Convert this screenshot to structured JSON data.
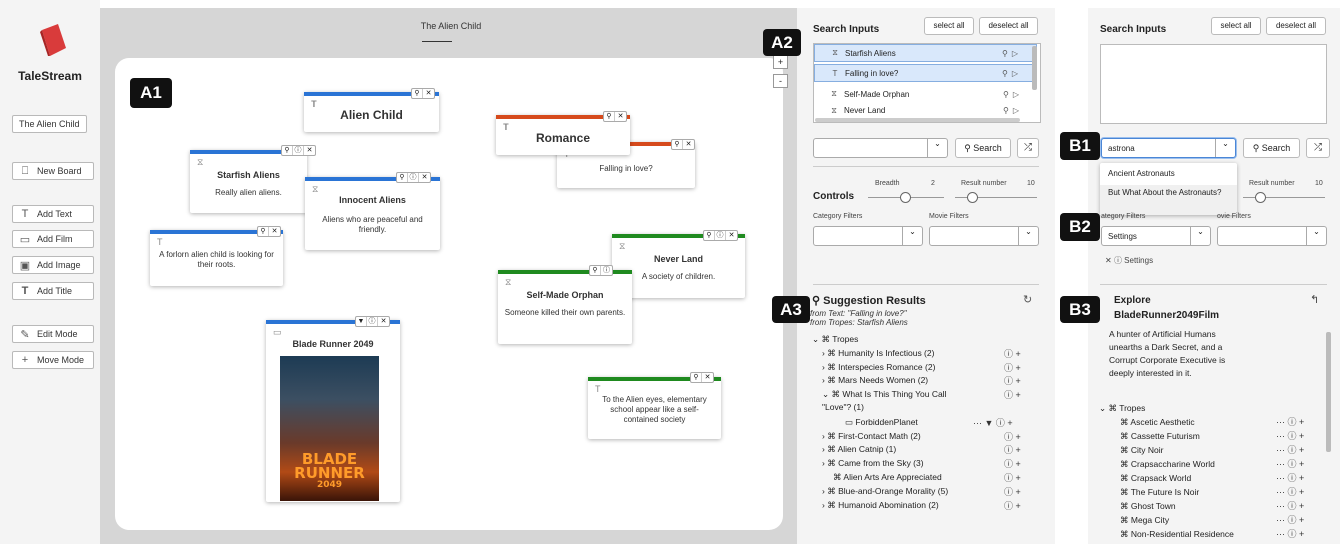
{
  "app": {
    "name": "TaleStream",
    "board_name_button": "The Alien Child",
    "tools": [
      "New Board",
      "Add Text",
      "Add Film",
      "Add Image",
      "Add Title",
      "Edit Mode",
      "Move Mode"
    ],
    "tool_icons": [
      "new-board-icon",
      "text-icon",
      "film-icon",
      "image-icon",
      "title-icon",
      "pencil-icon",
      "move-icon"
    ]
  },
  "board": {
    "tab_title": "The Alien Child",
    "zoom_in": "+",
    "zoom_out": "-",
    "badge": "A1",
    "cards": {
      "alien_child": {
        "title": "Alien Child"
      },
      "romance": {
        "title": "Romance"
      },
      "falling": {
        "desc": "Falling in love?"
      },
      "starfish": {
        "title": "Starfish Aliens",
        "desc": "Really alien aliens."
      },
      "innocent": {
        "title": "Innocent Aliens",
        "desc": "Aliens who are peaceful and friendly."
      },
      "forlorn": {
        "desc": "A forlorn alien child is looking for their roots."
      },
      "never_land": {
        "title": "Never Land",
        "desc": "A society of children."
      },
      "orphan": {
        "title": "Self-Made Orphan",
        "desc": "Someone killed their own parents."
      },
      "blade": {
        "title": "Blade Runner 2049",
        "poster_line1": "BLADE",
        "poster_line2": "RUNNER",
        "poster_line3": "2049"
      },
      "elementary": {
        "desc": "To the Alien eyes, elementary school appear like a self-contained society"
      }
    },
    "colors": {
      "blue": "#2a74d5",
      "red": "#d64a1c",
      "green": "#1f8a1f"
    }
  },
  "search_panel": {
    "badge": "A2",
    "title": "Search Inputs",
    "select_all": "select all",
    "deselect_all": "deselect all",
    "inputs": [
      {
        "label": "Starfish Aliens",
        "selected": true
      },
      {
        "label": "Falling in love?",
        "selected": true
      },
      {
        "label": "Self-Made Orphan",
        "selected": false
      },
      {
        "label": "Never Land",
        "selected": false
      }
    ],
    "search_button": "Search",
    "controls_title": "Controls",
    "breadth_label": "Breadth",
    "breadth_value": "2",
    "result_number_label": "Result number",
    "result_number_value": "10",
    "category_filters": "Category Filters",
    "movie_filters": "Movie Filters"
  },
  "suggestions": {
    "badge": "A3",
    "title": "Suggestion Results",
    "from_text": "from Text: \"Falling in love?\"",
    "from_tropes": "from Tropes: Starfish Aliens",
    "root": "Tropes",
    "items": [
      "Humanity Is Infectious (2)",
      "Interspecies Romance (2)",
      "Mars Needs Women (2)",
      "What Is This Thing You Call",
      "\"Love\"? (1)",
      "ForbiddenPlanet",
      "First-Contact Math (2)",
      "Alien Catnip (1)",
      "Came from the Sky (3)",
      "Alien Arts Are Appreciated",
      "Blue-and-Orange Morality (5)",
      "Humanoid Abomination (2)"
    ]
  },
  "right_panel": {
    "title": "Search Inputs",
    "select_all": "select all",
    "deselect_all": "deselect all",
    "search_value": "astrona",
    "search_button": "Search",
    "dropdown_options": [
      "Ancient Astronauts",
      "But What About the Astronauts?"
    ],
    "result_number_label": "Result number",
    "result_number_value": "10",
    "category_filters_partial": "ategory Filters",
    "movie_filters_partial": "ovie Filters",
    "category_value": "Settings",
    "chip_label": "Settings",
    "badge_b1": "B1",
    "badge_b2": "B2",
    "badge_b3": "B3",
    "explore_title": "Explore",
    "explore_film": "BladeRunner2049Film",
    "explore_desc": "A hunter of Artificial Humans unearths a Dark Secret, and a Corrupt Corporate Executive is deeply interested in it.",
    "tropes_root": "Tropes",
    "tropes": [
      "Ascetic Aesthetic",
      "Cassette Futurism",
      "City Noir",
      "Crapsaccharine World",
      "Crapsack World",
      "The Future Is Noir",
      "Ghost Town",
      "Mega City",
      "Non-Residential Residence"
    ]
  }
}
